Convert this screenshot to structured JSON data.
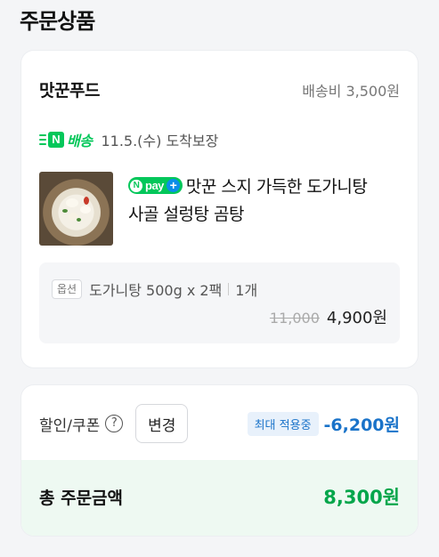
{
  "section_title": "주문상품",
  "order": {
    "seller_name": "맛꾼푸드",
    "shipping_fee": "배송비 3,500원",
    "delivery": {
      "badge_letter": "N",
      "label": "배송",
      "date_text": "11.5.(수) 도착보장"
    },
    "npay_badge": {
      "n": "N",
      "text": "pay",
      "plus": "+"
    },
    "product_name_line1": "맛꾼 스지 가득한 도가니탕",
    "product_name_line2": "사골 설렁탕 곰탕",
    "option": {
      "tag": "옵션",
      "text": "도가니탕 500g x 2팩",
      "quantity": "1개",
      "original_price": "11,000",
      "sale_price": "4,900원"
    }
  },
  "summary": {
    "discount_label": "할인/쿠폰",
    "help_icon": "?",
    "change_button": "변경",
    "max_badge": "최대 적용중",
    "discount_amount": "-6,200원",
    "total_label": "총 주문금액",
    "total_amount": "8,300원"
  },
  "colors": {
    "naver_green": "#03c75a",
    "discount_blue": "#1a73c9",
    "total_green": "#03a64b"
  }
}
